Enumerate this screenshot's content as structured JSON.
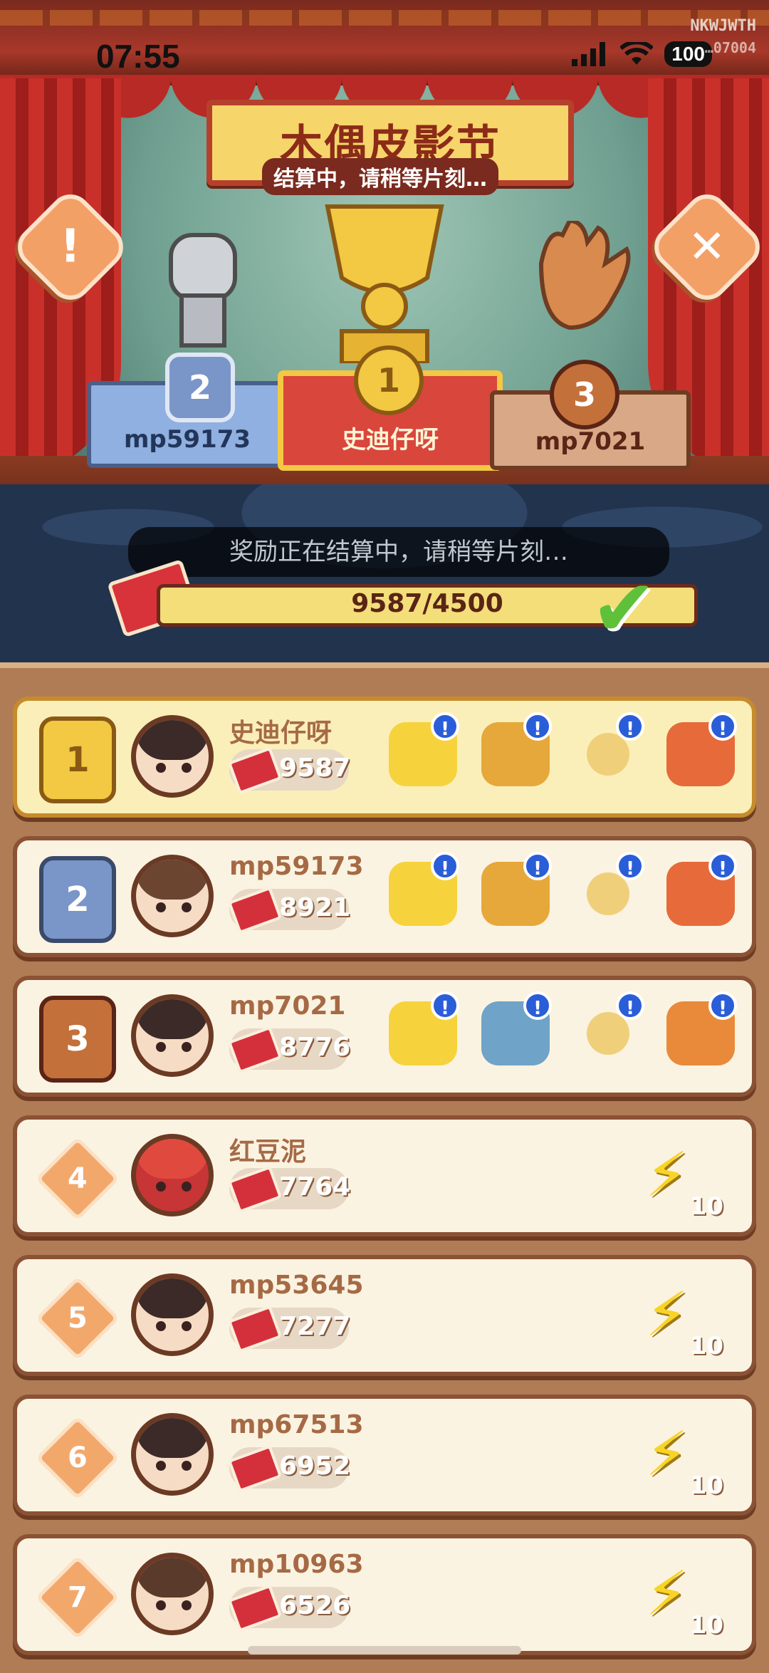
{
  "status_bar": {
    "time": "07:55",
    "battery": "100"
  },
  "watermark": {
    "line1": "NKWJWTH",
    "line2": "…07004"
  },
  "event": {
    "title": "木偶皮影节",
    "subtitle": "结算中，请稍等片刻…"
  },
  "buttons": {
    "info_icon": "!",
    "close_icon": "✕"
  },
  "podium": [
    {
      "rank": "1",
      "name": "史迪仔呀"
    },
    {
      "rank": "2",
      "name": "mp59173"
    },
    {
      "rank": "3",
      "name": "mp7021"
    }
  ],
  "progress": {
    "notice": "奖励正在结算中，请稍等片刻…",
    "text": "9587/4500",
    "check_icon": "✔"
  },
  "leaderboard": [
    {
      "rank": "1",
      "name": "史迪仔呀",
      "score": "9587"
    },
    {
      "rank": "2",
      "name": "mp59173",
      "score": "8921"
    },
    {
      "rank": "3",
      "name": "mp7021",
      "score": "8776"
    },
    {
      "rank": "4",
      "name": "红豆泥",
      "score": "7764",
      "reward_count": "10"
    },
    {
      "rank": "5",
      "name": "mp53645",
      "score": "7277",
      "reward_count": "10"
    },
    {
      "rank": "6",
      "name": "mp67513",
      "score": "6952",
      "reward_count": "10"
    },
    {
      "rank": "7",
      "name": "mp10963",
      "score": "6526",
      "reward_count": "10"
    }
  ],
  "reward_info_glyph": "!",
  "lightning_glyph": "⚡",
  "colors": {
    "gold": "#f3c842",
    "silver": "#9fb4d6",
    "bronze": "#d98a4e",
    "accent": "#8c2b18"
  }
}
